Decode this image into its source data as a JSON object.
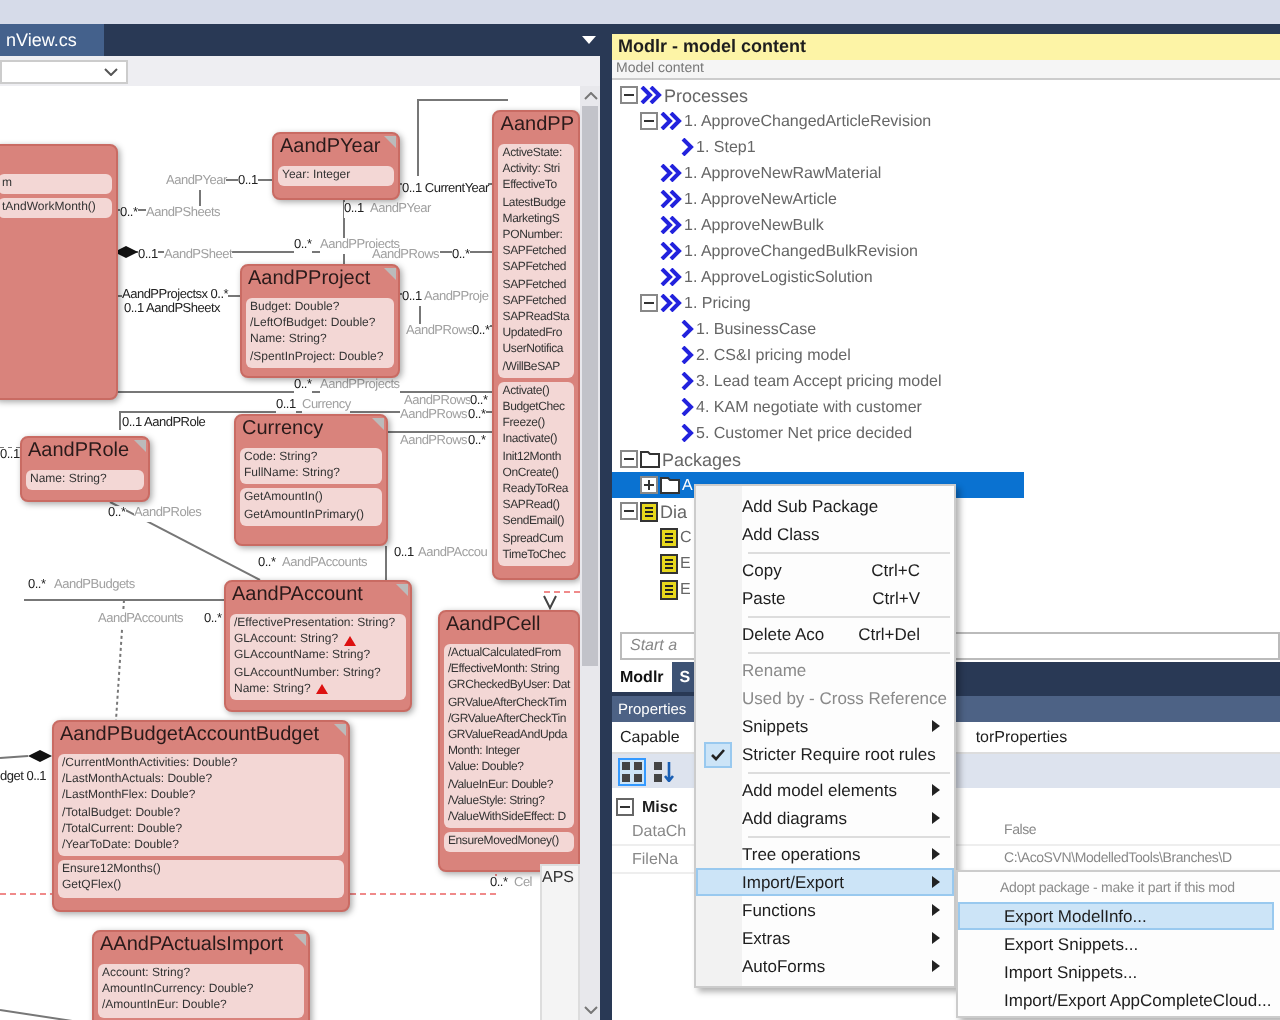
{
  "editor_tabs": [
    {
      "title": "nView.cs",
      "selected": true
    }
  ],
  "diagram": {
    "classes": [
      {
        "attributes": [
          "m"
        ],
        "methods": [
          "tAndWorkMonth()"
        ]
      },
      {
        "name": "AandPYear",
        "attributes": [
          "Year: Integer"
        ]
      },
      {
        "name": "AandPP",
        "attributes": [
          "ActiveState:",
          "Activity: Stri",
          "EffectiveTo",
          "LatestBudge",
          "MarketingS",
          "PONumber:",
          "SAPFetched",
          "SAPFetched",
          "SAPFetched",
          "SAPFetched",
          "SAPReadSta",
          "UpdatedFro",
          "UserNotifica",
          "/WillBeSAP"
        ],
        "methods": [
          "Activate()",
          "BudgetChec",
          "Freeze()",
          "Inactivate()",
          "Init12Month",
          "OnCreate()",
          "ReadyToRea",
          "SAPRead()",
          "SendEmail()",
          "SpreadCum",
          "TimeToChec"
        ]
      },
      {
        "name": "AandPProject",
        "attributes": [
          "Budget: Double?",
          "/LeftOfBudget: Double?",
          "Name: String?",
          "/SpentInProject: Double?"
        ]
      },
      {
        "name": "AandPRole",
        "attributes": [
          "Name: String?"
        ]
      },
      {
        "name": "Currency",
        "attributes": [
          "Code: String?",
          "FullName: String?"
        ],
        "methods": [
          "GetAmountIn()",
          "GetAmountInPrimary()"
        ]
      },
      {
        "name": "AandPAccount",
        "attributes": [
          {
            "text": "/EffectivePresentation: String?",
            "warning": false
          },
          {
            "text": "GLAccount: String?",
            "warning": true
          },
          {
            "text": "GLAccountName: String?",
            "warning": false
          },
          {
            "text": "GLAccountNumber: String?",
            "warning": false
          },
          {
            "text": "Name: String?",
            "warning": true
          }
        ]
      },
      {
        "name": "AandPCell",
        "attributes": [
          "/ActualCalculatedFrom",
          "/EffectiveMonth: String",
          "GRCheckedByUser: Dat",
          "GRValueAfterCheckTim",
          "/GRValueAfterCheckTin",
          "GRValueReadAndUpda",
          "Month: Integer",
          "Value: Double?",
          "/ValueInEur: Double?",
          "/ValueStyle: String?",
          "/ValueWithSideEffect: D"
        ],
        "methods": [
          "EnsureMovedMoney()"
        ]
      },
      {
        "name": "AandPBudgetAccountBudget",
        "attributes": [
          "/CurrentMonthActivities: Double?",
          "/LastMonthActuals: Double?",
          "/LastMonthFlex: Double?",
          "/TotalBudget: Double?",
          "/TotalCurrent: Double?",
          "/YearToDate: Double?"
        ],
        "methods": [
          "Ensure12Months()",
          "GetQFlex()"
        ]
      },
      {
        "name": "AAndPActualsImport",
        "attributes": [
          "Account: String?",
          "AmountInCurrency: Double?",
          "/AmountInEur: Double?"
        ]
      }
    ],
    "connector_labels": [
      {
        "text": "AandPYear",
        "kind": "role"
      },
      {
        "text": "0..1",
        "kind": "multiplicity"
      },
      {
        "text": "0..*",
        "kind": "multiplicity"
      },
      {
        "text": "AandPSheets",
        "kind": "role"
      },
      {
        "text": "0..1 CurrentYear",
        "kind": "multiplicity"
      },
      {
        "text": "0..1",
        "kind": "multiplicity"
      },
      {
        "text": "AandPYear",
        "kind": "role"
      },
      {
        "text": "0..*",
        "kind": "multiplicity"
      },
      {
        "text": "AandPProjects",
        "kind": "role"
      },
      {
        "text": "0..1",
        "kind": "multiplicity"
      },
      {
        "text": "AandPSheet",
        "kind": "role"
      },
      {
        "text": "AandPRows",
        "kind": "role"
      },
      {
        "text": "0..*",
        "kind": "multiplicity"
      },
      {
        "text": "AandPProjectsx 0..*",
        "kind": "multiplicity"
      },
      {
        "text": "0..1 AandPSheetx",
        "kind": "multiplicity"
      },
      {
        "text": "0..1",
        "kind": "multiplicity"
      },
      {
        "text": "AandPProje",
        "kind": "role"
      },
      {
        "text": "AandPRows",
        "kind": "role"
      },
      {
        "text": "0..*",
        "kind": "multiplicity"
      },
      {
        "text": "0..*",
        "kind": "multiplicity"
      },
      {
        "text": "AandPProjects",
        "kind": "role"
      },
      {
        "text": "AandPRows",
        "kind": "role"
      },
      {
        "text": "0..*",
        "kind": "multiplicity"
      },
      {
        "text": "0..1",
        "kind": "multiplicity"
      },
      {
        "text": "Currency",
        "kind": "role"
      },
      {
        "text": "AandPRows",
        "kind": "role"
      },
      {
        "text": "0..*",
        "kind": "multiplicity"
      },
      {
        "text": "0..1 AandPRole",
        "kind": "multiplicity"
      },
      {
        "text": "AandPRows",
        "kind": "role"
      },
      {
        "text": "0..*",
        "kind": "multiplicity"
      },
      {
        "text": "0..1",
        "kind": "multiplicity"
      },
      {
        "text": "0..*",
        "kind": "multiplicity"
      },
      {
        "text": "AandPRoles",
        "kind": "role"
      },
      {
        "text": "0..*",
        "kind": "multiplicity"
      },
      {
        "text": "AandPAccounts",
        "kind": "role"
      },
      {
        "text": "0..1",
        "kind": "multiplicity"
      },
      {
        "text": "AandPAccou",
        "kind": "role"
      },
      {
        "text": "0..*",
        "kind": "multiplicity"
      },
      {
        "text": "AandPBudgets",
        "kind": "role"
      },
      {
        "text": "AandPAccounts",
        "kind": "role"
      },
      {
        "text": "0..*",
        "kind": "multiplicity"
      },
      {
        "text": "dget 0..1",
        "kind": "multiplicity"
      },
      {
        "text": "0..*",
        "kind": "multiplicity"
      },
      {
        "text": "Cel",
        "kind": "role"
      }
    ],
    "overview": {
      "label": "APS"
    }
  },
  "model_panel": {
    "title": "Modlr - model content",
    "column": "Model content"
  },
  "model_tree": [
    {
      "label": "Processes",
      "kind": "process",
      "expanded": true,
      "selected": false,
      "children": [
        {
          "label": "1. ApproveChangedArticleRevision",
          "kind": "process",
          "expanded": true,
          "selected": false,
          "children": [
            {
              "label": "1. Step1",
              "kind": "step",
              "selected": false
            }
          ]
        },
        {
          "label": "1. ApproveNewRawMaterial",
          "kind": "process",
          "selected": false
        },
        {
          "label": "1. ApproveNewArticle",
          "kind": "process",
          "selected": false
        },
        {
          "label": "1. ApproveNewBulk",
          "kind": "process",
          "selected": false
        },
        {
          "label": "1. ApproveChangedBulkRevision",
          "kind": "process",
          "selected": false
        },
        {
          "label": "1. ApproveLogisticSolution",
          "kind": "process",
          "selected": false
        },
        {
          "label": "1. Pricing",
          "kind": "process",
          "expanded": true,
          "selected": false,
          "children": [
            {
              "label": "1. BusinessCase",
              "kind": "step",
              "selected": false
            },
            {
              "label": "2. CS&I pricing model",
              "kind": "step",
              "selected": false
            },
            {
              "label": "3. Lead team Accept pricing model",
              "kind": "step",
              "selected": false
            },
            {
              "label": "4. KAM negotiate with customer",
              "kind": "step",
              "selected": false
            },
            {
              "label": "5. Customer Net price decided",
              "kind": "step",
              "selected": false
            }
          ]
        }
      ]
    },
    {
      "label": "Packages",
      "kind": "folder",
      "expanded": true,
      "selected": false,
      "children": [
        {
          "label": "A",
          "kind": "folder",
          "expanded": false,
          "selected": true
        }
      ]
    },
    {
      "label": "Dia",
      "kind": "diagram",
      "expanded": true,
      "selected": false,
      "children": [
        {
          "label": "C",
          "kind": "diagram",
          "selected": false
        },
        {
          "label": "E",
          "kind": "diagram",
          "selected": false
        },
        {
          "label": "E",
          "kind": "diagram",
          "selected": false
        }
      ]
    }
  ],
  "search": {
    "placeholder": "Start a"
  },
  "panel_tabs": [
    {
      "label": "Modlr",
      "selected": true
    },
    {
      "label": "S",
      "selected": false
    }
  ],
  "properties": {
    "title": "Properties",
    "object_name_start": "Capable",
    "object_name_end": "torProperties",
    "toolbar": [
      {
        "kind": "categorized",
        "selected": true
      },
      {
        "kind": "alphabetical",
        "selected": false
      }
    ],
    "category": "Misc",
    "category_expanded": true,
    "rows": [
      {
        "name": "DataCh",
        "value": "False"
      },
      {
        "name": "FileNa",
        "value": "C:\\AcoSVN\\ModelledTools\\Branches\\D"
      }
    ]
  },
  "context_menu": {
    "items": [
      {
        "kind": "item",
        "label": "Add Sub Package",
        "submenu": false,
        "disabled": false,
        "checked": false,
        "selected": false
      },
      {
        "kind": "item",
        "label": "Add Class",
        "submenu": false,
        "disabled": false,
        "checked": false,
        "selected": false
      },
      {
        "kind": "separator"
      },
      {
        "kind": "item",
        "label": "Copy",
        "shortcut": "Ctrl+C",
        "submenu": false,
        "disabled": false,
        "checked": false,
        "selected": false
      },
      {
        "kind": "item",
        "label": "Paste",
        "shortcut": "Ctrl+V",
        "submenu": false,
        "disabled": false,
        "checked": false,
        "selected": false
      },
      {
        "kind": "separator"
      },
      {
        "kind": "item",
        "label": "Delete Aco",
        "shortcut": "Ctrl+Del",
        "submenu": false,
        "disabled": false,
        "checked": false,
        "selected": false
      },
      {
        "kind": "separator"
      },
      {
        "kind": "item",
        "label": "Rename",
        "submenu": false,
        "disabled": true,
        "checked": false,
        "selected": false
      },
      {
        "kind": "item",
        "label": "Used by - Cross Reference",
        "submenu": false,
        "disabled": true,
        "checked": false,
        "selected": false
      },
      {
        "kind": "item",
        "label": "Snippets",
        "submenu": true,
        "disabled": false,
        "checked": false,
        "selected": false
      },
      {
        "kind": "item",
        "label": "Stricter Require root rules",
        "submenu": false,
        "disabled": false,
        "checked": true,
        "selected": false
      },
      {
        "kind": "separator"
      },
      {
        "kind": "item",
        "label": "Add model elements",
        "submenu": true,
        "disabled": false,
        "checked": false,
        "selected": false
      },
      {
        "kind": "item",
        "label": "Add diagrams",
        "submenu": true,
        "disabled": false,
        "checked": false,
        "selected": false
      },
      {
        "kind": "separator"
      },
      {
        "kind": "item",
        "label": "Tree operations",
        "submenu": true,
        "disabled": false,
        "checked": false,
        "selected": false
      },
      {
        "kind": "item",
        "label": "Import/Export",
        "submenu": true,
        "disabled": false,
        "checked": false,
        "selected": true
      },
      {
        "kind": "item",
        "label": "Functions",
        "submenu": true,
        "disabled": false,
        "checked": false,
        "selected": false
      },
      {
        "kind": "item",
        "label": "Extras",
        "submenu": true,
        "disabled": false,
        "checked": false,
        "selected": false
      },
      {
        "kind": "item",
        "label": "AutoForms",
        "submenu": true,
        "disabled": false,
        "checked": false,
        "selected": false
      }
    ]
  },
  "submenu": {
    "items": [
      {
        "label": "Adopt package - make it part if this mod",
        "disabled": true,
        "selected": false
      },
      {
        "label": "Export ModelInfo...",
        "disabled": false,
        "selected": true
      },
      {
        "label": "Export Snippets...",
        "disabled": false,
        "selected": false
      },
      {
        "label": "Import Snippets...",
        "disabled": false,
        "selected": false
      },
      {
        "label": "Import/Export AppCompleteCloud...",
        "disabled": false,
        "selected": false
      }
    ]
  }
}
